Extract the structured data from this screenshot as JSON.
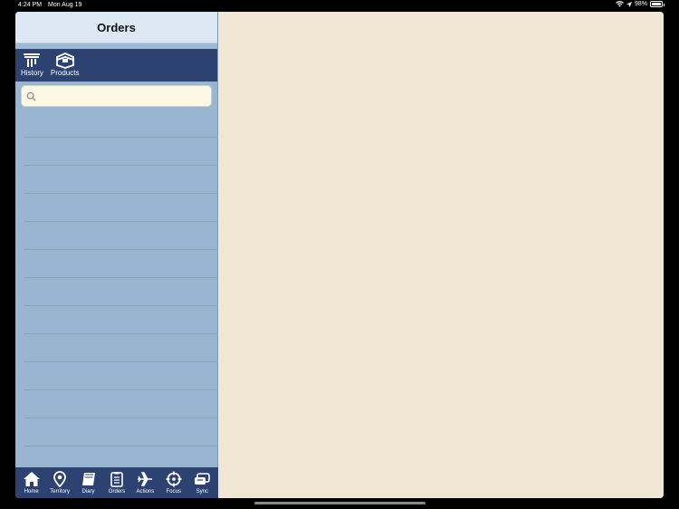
{
  "statusbar": {
    "time": "4:24 PM",
    "date": "Mon Aug 19",
    "battery": "98%"
  },
  "sidebar": {
    "title": "Orders",
    "toolbar": [
      {
        "label": "History",
        "icon": "history-column-icon"
      },
      {
        "label": "Products",
        "icon": "products-box-icon"
      }
    ],
    "search": {
      "value": "",
      "placeholder": ""
    }
  },
  "tabbar": [
    {
      "label": "Home",
      "icon": "home-icon"
    },
    {
      "label": "Territory",
      "icon": "territory-pin-icon"
    },
    {
      "label": "Diary",
      "icon": "diary-book-icon"
    },
    {
      "label": "Orders",
      "icon": "orders-clipboard-icon"
    },
    {
      "label": "Actions",
      "icon": "actions-plane-icon"
    },
    {
      "label": "Focus",
      "icon": "focus-target-icon"
    },
    {
      "label": "Sync",
      "icon": "sync-icon"
    }
  ],
  "colors": {
    "sidebar_bg": "#98b6d2",
    "toolbar_bg": "#2d4271",
    "content_bg": "#efe7d4",
    "title_bg": "#dde8f5"
  }
}
